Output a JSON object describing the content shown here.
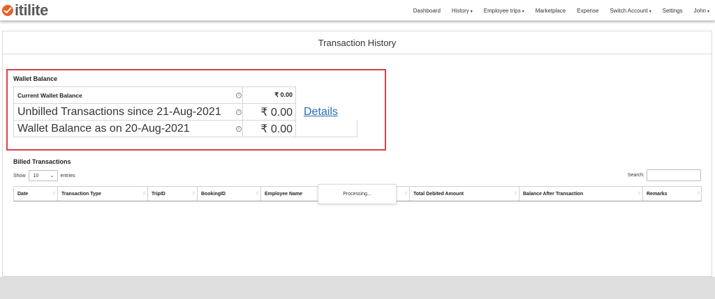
{
  "brand": {
    "logo_text": "itilite",
    "accent_color": "#e8622a"
  },
  "nav": {
    "dashboard": "Dashboard",
    "history": "History",
    "employee_trips": "Employee trips",
    "marketplace": "Marketplace",
    "expense": "Expense",
    "switch_account": "Switch Account",
    "settings": "Settings",
    "user": "John"
  },
  "page": {
    "title": "Transaction History"
  },
  "wallet": {
    "title": "Wallet Balance",
    "highlight_color": "#d9404a",
    "rows": [
      {
        "label": "Current Wallet Balance",
        "amount": "₹ 0.00",
        "link": ""
      },
      {
        "label": "Unbilled Transactions since 21-Aug-2021",
        "amount": "₹ 0.00",
        "link": "Details"
      },
      {
        "label": "Wallet Balance as on 20-Aug-2021",
        "amount": "₹ 0.00",
        "link": ""
      }
    ]
  },
  "billed": {
    "title": "Billed Transactions",
    "show_label": "Show",
    "entries_value": "10",
    "entries_label": "entries",
    "search_label": "Search:",
    "search_value": "",
    "columns": [
      "Date",
      "Transaction Type",
      "TripID",
      "BookingID",
      "Employee Name",
      "",
      "Total Debited Amount",
      "Balance After Transaction",
      "Remarks"
    ],
    "processing_text": "Processing..."
  }
}
